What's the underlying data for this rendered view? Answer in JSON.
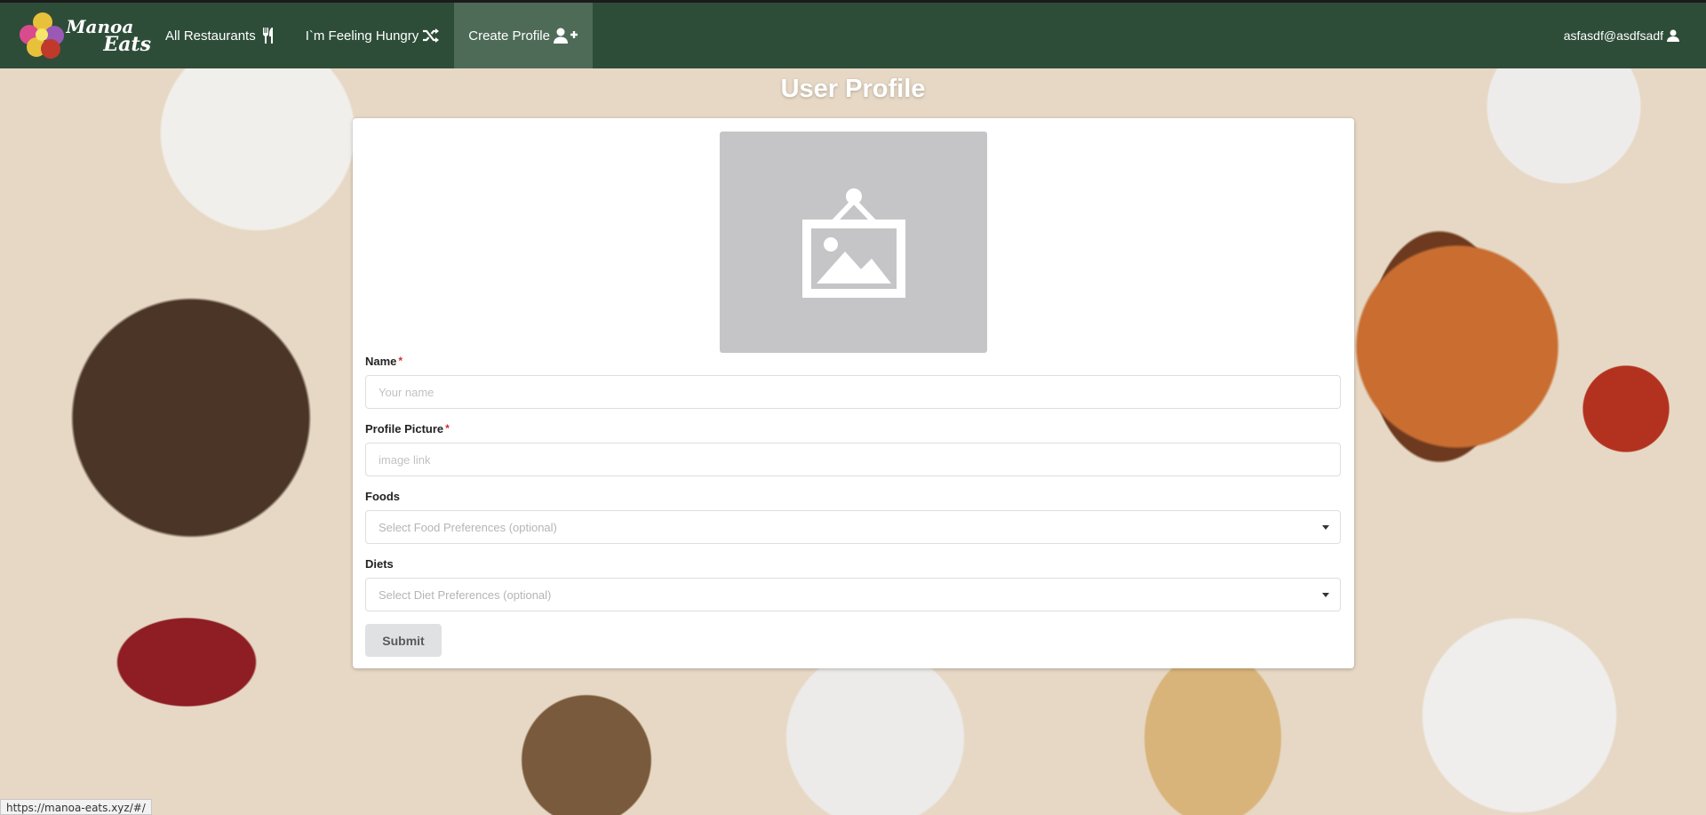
{
  "brand": {
    "line1": "Manoa",
    "line2": "Eats"
  },
  "nav": {
    "items": [
      {
        "label": "All Restaurants",
        "icon": "utensils-icon"
      },
      {
        "label": "I`m Feeling Hungry",
        "icon": "shuffle-icon"
      },
      {
        "label": "Create Profile",
        "icon": "user-plus-icon",
        "active": true
      }
    ],
    "user": {
      "label": "asfasdf@asdfsadf",
      "icon": "user-icon"
    }
  },
  "page": {
    "title": "User Profile"
  },
  "form": {
    "image_placeholder_icon": "image-placeholder-icon",
    "name": {
      "label": "Name",
      "required_mark": "*",
      "placeholder": "Your name",
      "value": ""
    },
    "picture": {
      "label": "Profile Picture",
      "required_mark": "*",
      "placeholder": "image link",
      "value": ""
    },
    "foods": {
      "label": "Foods",
      "placeholder": "Select Food Preferences (optional)"
    },
    "diets": {
      "label": "Diets",
      "placeholder": "Select Diet Preferences (optional)"
    },
    "submit_label": "Submit"
  },
  "status_bar": {
    "url": "https://manoa-eats.xyz/#/"
  },
  "colors": {
    "navbar": "#2e4d39",
    "nav_active": "#4e6b58",
    "required": "#db2828",
    "button": "#e0e1e2"
  }
}
